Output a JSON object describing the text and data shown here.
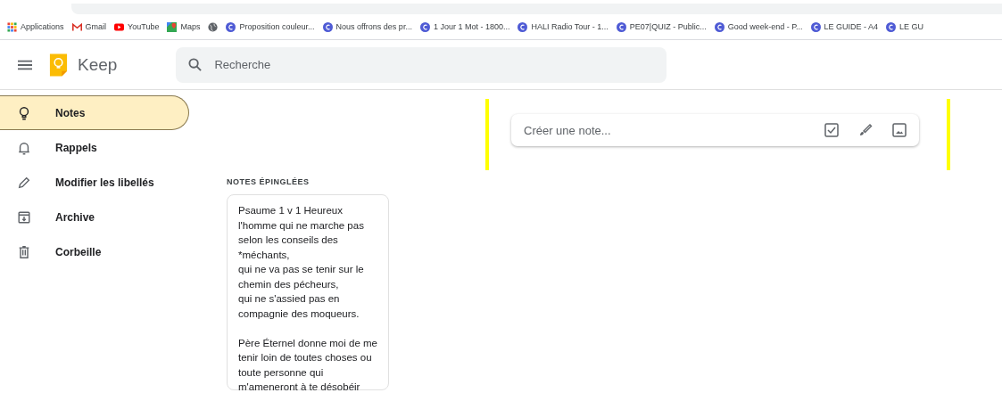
{
  "bookmarks": [
    {
      "label": "Applications",
      "kind": "apps"
    },
    {
      "label": "Gmail",
      "kind": "gmail"
    },
    {
      "label": "YouTube",
      "kind": "youtube"
    },
    {
      "label": "Maps",
      "kind": "maps"
    },
    {
      "kind": "globe"
    },
    {
      "label": "Proposition couleur...",
      "kind": "site"
    },
    {
      "label": "Nous offrons des pr...",
      "kind": "site"
    },
    {
      "label": "1 Jour 1 Mot - 1800...",
      "kind": "site"
    },
    {
      "label": "HALI Radio Tour - 1...",
      "kind": "site"
    },
    {
      "label": "PE07|QUIZ - Public...",
      "kind": "site"
    },
    {
      "label": "Good week-end - P...",
      "kind": "site"
    },
    {
      "label": "LE GUIDE - A4",
      "kind": "site"
    },
    {
      "label": "LE GU",
      "kind": "site"
    }
  ],
  "header": {
    "app_name": "Keep",
    "search": {
      "placeholder": "Recherche"
    }
  },
  "sidebar": {
    "items": [
      {
        "label": "Notes",
        "kind": "notes",
        "selected": true
      },
      {
        "label": "Rappels",
        "kind": "reminders",
        "selected": false
      },
      {
        "label": "Modifier les libellés",
        "kind": "labels",
        "selected": false
      },
      {
        "label": "Archive",
        "kind": "archive",
        "selected": false
      },
      {
        "label": "Corbeille",
        "kind": "trash",
        "selected": false
      }
    ]
  },
  "composer": {
    "placeholder": "Créer une note..."
  },
  "pinned": {
    "heading": "NOTES ÉPINGLÉES",
    "notes": [
      {
        "paragraphs": [
          [
            "Psaume 1 v 1  Heureux",
            "l'homme qui ne marche pas",
            "selon les conseils des",
            "*méchants,",
            "qui ne va pas se tenir sur le",
            "chemin des pécheurs,",
            "qui ne s'assied pas en",
            "compagnie des moqueurs."
          ],
          [
            "Père Éternel donne moi de me",
            "tenir loin de toutes choses ou",
            "toute personne qui",
            "m'ameneront à te désobéir"
          ]
        ]
      }
    ]
  }
}
